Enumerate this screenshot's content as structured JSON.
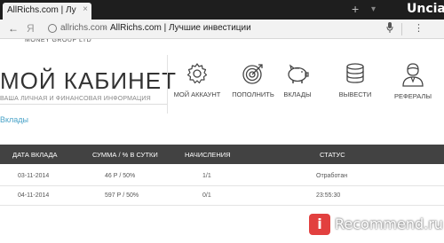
{
  "browser": {
    "tab_title": "AllRichs.com | Лучшие",
    "tab_close": "×",
    "new_tab": "+",
    "window_control": "▾",
    "watermark_top": "Uncia",
    "back": "←",
    "search_logo": "Я",
    "url_domain": "allrichs.com",
    "url_separator": "›",
    "url_title": "AllRichs.com | Лучшие инвестиции",
    "mic": "🎙",
    "menu": "⋮"
  },
  "page": {
    "brand_strip": "MONEY GROUP LTD",
    "title": "МОЙ КАБИНЕТ",
    "subtitle": "ВАША ЛИЧНАЯ И ФИНАНСОВАЯ ИНФОРМАЦИЯ",
    "section_link": "Вклады"
  },
  "nav": [
    {
      "label": "МОЙ АККАУНТ",
      "icon": "gear-icon"
    },
    {
      "label": "ПОПОЛНИТЬ",
      "icon": "target-icon"
    },
    {
      "label": "ВКЛАДЫ",
      "icon": "piggy-bank-icon"
    },
    {
      "label": "ВЫВЕСТИ",
      "icon": "coin-stack-icon"
    },
    {
      "label": "РЕФЕРАЛЫ",
      "icon": "user-icon"
    }
  ],
  "table": {
    "headers": [
      "ДАТА ВКЛАДА",
      "СУММА / % В СУТКИ",
      "НАЧИСЛЕНИЯ",
      "СТАТУС"
    ],
    "rows": [
      {
        "date": "03-11-2014",
        "amount": "46 Р / 50%",
        "accruals": "1/1",
        "status": "Отработан"
      },
      {
        "date": "04-11-2014",
        "amount": "597 Р / 50%",
        "accruals": "0/1",
        "status": "23:55:30"
      }
    ]
  },
  "watermark": {
    "badge": "i",
    "text": "Recommend.ru"
  },
  "colors": {
    "accent_link": "#4aa3c8",
    "table_header": "#424242",
    "icon": "#444444"
  }
}
